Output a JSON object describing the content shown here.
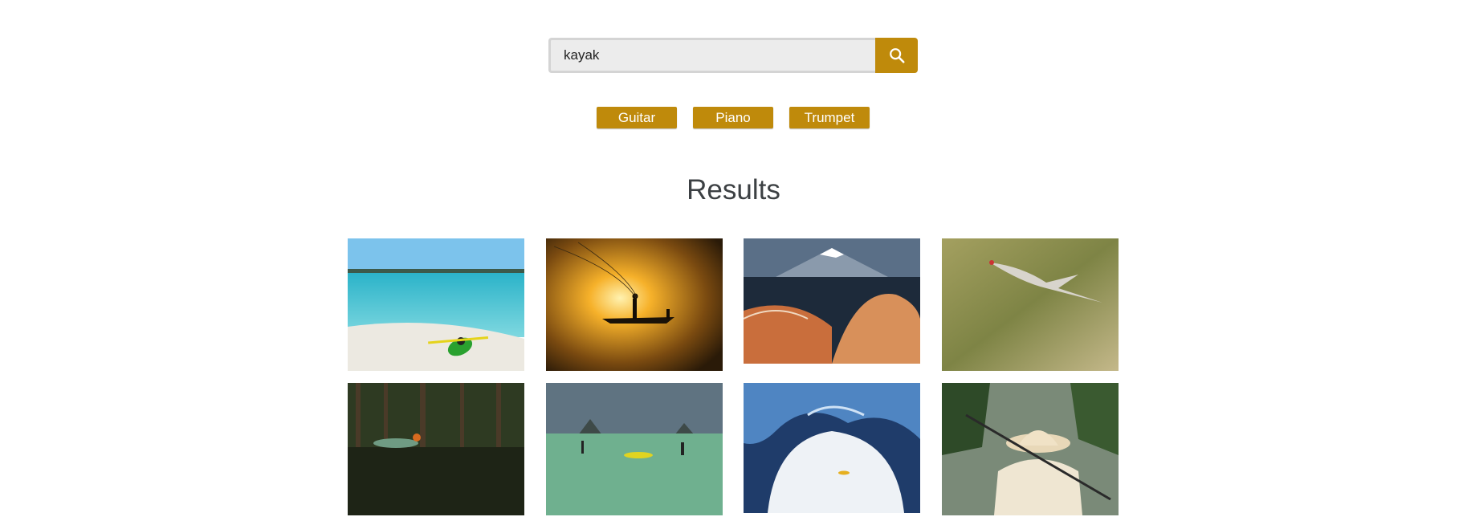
{
  "search": {
    "value": "kayak",
    "placeholder": "",
    "button_icon": "search-icon"
  },
  "categories": [
    "Guitar",
    "Piano",
    "Trumpet"
  ],
  "results": {
    "title": "Results",
    "images": [
      {
        "subject": "kayak-beach-icon"
      },
      {
        "subject": "fisherman-sunset-icon"
      },
      {
        "subject": "mountain-boat-icon"
      },
      {
        "subject": "crane-flight-icon"
      },
      {
        "subject": "mangrove-kayak-icon"
      },
      {
        "subject": "green-sea-kayak-icon"
      },
      {
        "subject": "ice-cave-kayak-icon"
      },
      {
        "subject": "river-paddler-icon"
      }
    ]
  },
  "colors": {
    "accent": "#bf8a0b",
    "input_bg": "#ececec",
    "heading": "#3c4043"
  }
}
